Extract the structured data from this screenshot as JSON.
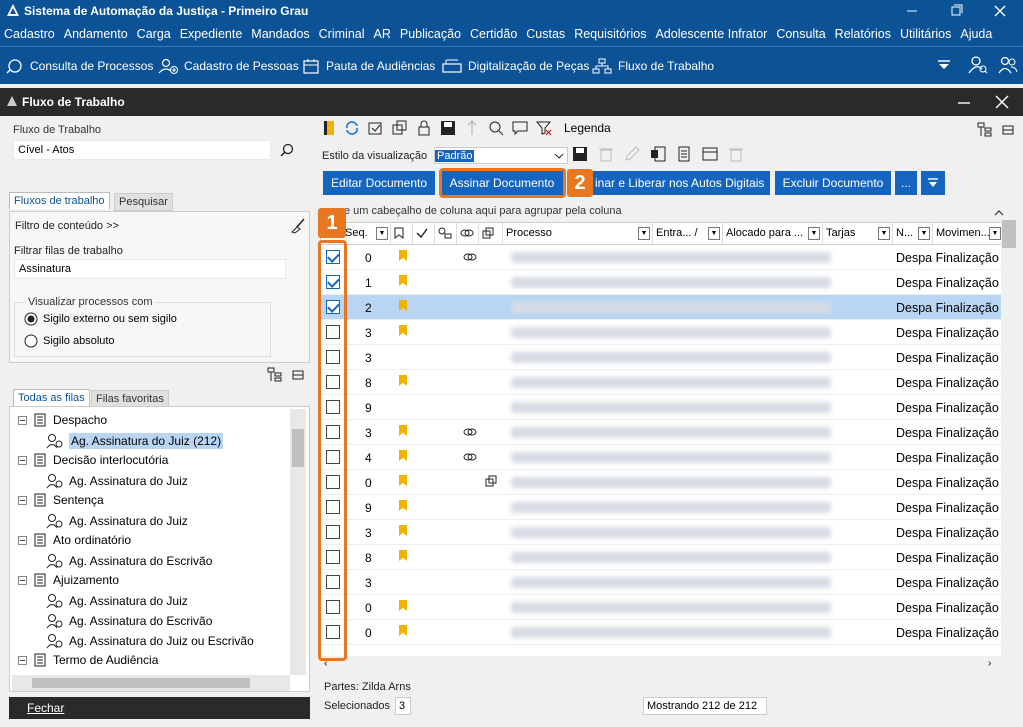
{
  "window": {
    "title": "Sistema de Automação da Justiça - Primeiro Grau"
  },
  "menu": [
    "Cadastro",
    "Andamento",
    "Carga",
    "Expediente",
    "Mandados",
    "Criminal",
    "AR",
    "Publicação",
    "Certidão",
    "Custas",
    "Requisitórios",
    "Adolescente Infrator",
    "Consulta",
    "Relatórios",
    "Utilitários",
    "Ajuda"
  ],
  "toolbar": {
    "consulta": "Consulta de Processos",
    "cadastro": "Cadastro de Pessoas",
    "pauta": "Pauta de Audiências",
    "digitalizacao": "Digitalização de Peças",
    "fluxo": "Fluxo de Trabalho"
  },
  "subwindow": {
    "title": "Fluxo de Trabalho"
  },
  "left": {
    "fluxo_label": "Fluxo de Trabalho",
    "fluxo_value": "Cível - Atos",
    "tabs": [
      "Fluxos de trabalho",
      "Pesquisar"
    ],
    "filtro_conteudo": "Filtro de conteúdo >>",
    "filtrar_filas_label": "Filtrar filas de trabalho",
    "filtrar_filas_value": "Assinatura",
    "visualizar_label": "Visualizar processos com",
    "radio1": "Sigilo externo ou sem sigilo",
    "radio2": "Sigilo absoluto",
    "tabs2": [
      "Todas as filas",
      "Filas favoritas"
    ],
    "tree": [
      {
        "label": "Despacho",
        "level": 0
      },
      {
        "label": "Ag. Assinatura do Juiz (212)",
        "level": 1,
        "selected": true
      },
      {
        "label": "Decisão interlocutória",
        "level": 0
      },
      {
        "label": "Ag. Assinatura do Juiz",
        "level": 1
      },
      {
        "label": "Sentença",
        "level": 0
      },
      {
        "label": "Ag. Assinatura do Juiz",
        "level": 1
      },
      {
        "label": "Ato ordinatório",
        "level": 0
      },
      {
        "label": "Ag. Assinatura do Escrivão",
        "level": 1
      },
      {
        "label": "Ajuizamento",
        "level": 0
      },
      {
        "label": "Ag. Assinatura do Juiz",
        "level": 1
      },
      {
        "label": "Ag. Assinatura do Escrivão",
        "level": 1
      },
      {
        "label": "Ag. Assinatura do Juiz ou Escrivão",
        "level": 1
      },
      {
        "label": "Termo de Audiência",
        "level": 0
      }
    ],
    "fechar": "Fechar"
  },
  "right": {
    "legenda": "Legenda",
    "estilo_label": "Estilo da visualização",
    "estilo_value": "Padrão",
    "buttons": {
      "editar": "Editar Documento",
      "assinar": "Assinar Documento",
      "liberar": "inar e Liberar nos Autos Digitais",
      "excluir": "Excluir Documento",
      "more": "..."
    },
    "badge1": "1",
    "badge2": "2",
    "group_hint": "e um cabeçalho de coluna aqui para agrupar pela coluna",
    "columns": [
      "Seq.",
      "Processo",
      "Entra... /",
      "Alocado para ...",
      "Tarjas",
      "N...",
      "Movimen..."
    ],
    "rows": [
      {
        "seq": "0",
        "checked": true,
        "flag": true,
        "link": true,
        "mov": "Despa Finalização"
      },
      {
        "seq": "1",
        "checked": true,
        "flag": true,
        "link": false,
        "mov": "Despa Finalização"
      },
      {
        "seq": "2",
        "checked": true,
        "flag": true,
        "link": false,
        "mov": "Despa Finalização",
        "selected": true
      },
      {
        "seq": "3",
        "checked": false,
        "flag": true,
        "link": false,
        "mov": "Despa Finalização"
      },
      {
        "seq": "3",
        "checked": false,
        "flag": false,
        "link": false,
        "mov": "Despa Finalização"
      },
      {
        "seq": "8",
        "checked": false,
        "flag": true,
        "link": false,
        "mov": "Despa Finalização"
      },
      {
        "seq": "9",
        "checked": false,
        "flag": false,
        "link": false,
        "mov": "Despa Finalização"
      },
      {
        "seq": "3",
        "checked": false,
        "flag": true,
        "link": true,
        "mov": "Despa Finalização"
      },
      {
        "seq": "4",
        "checked": false,
        "flag": true,
        "link": true,
        "mov": "Despa Finalização"
      },
      {
        "seq": "0",
        "checked": false,
        "flag": true,
        "link": false,
        "mov": "Despa Finalização"
      },
      {
        "seq": "9",
        "checked": false,
        "flag": true,
        "link": false,
        "mov": "Despa Finalização"
      },
      {
        "seq": "3",
        "checked": false,
        "flag": true,
        "link": false,
        "mov": "Despa Finalização"
      },
      {
        "seq": "8",
        "checked": false,
        "flag": true,
        "link": false,
        "mov": "Despa Finalização"
      },
      {
        "seq": "3",
        "checked": false,
        "flag": false,
        "link": false,
        "mov": "Despa Finalização"
      },
      {
        "seq": "0",
        "checked": false,
        "flag": true,
        "link": false,
        "mov": "Despa Finalização"
      },
      {
        "seq": "0",
        "checked": false,
        "flag": true,
        "link": false,
        "mov": "Despa Finalização"
      }
    ],
    "partes": "Partes: Zilda Arns",
    "selecionados_label": "Selecionados",
    "selecionados_value": "3",
    "mostrando": "Mostrando 212 de 212"
  },
  "colors": {
    "brand": "#0b5296",
    "button": "#1565c0",
    "highlight": "#e87722",
    "selection": "#b8d6f4"
  }
}
